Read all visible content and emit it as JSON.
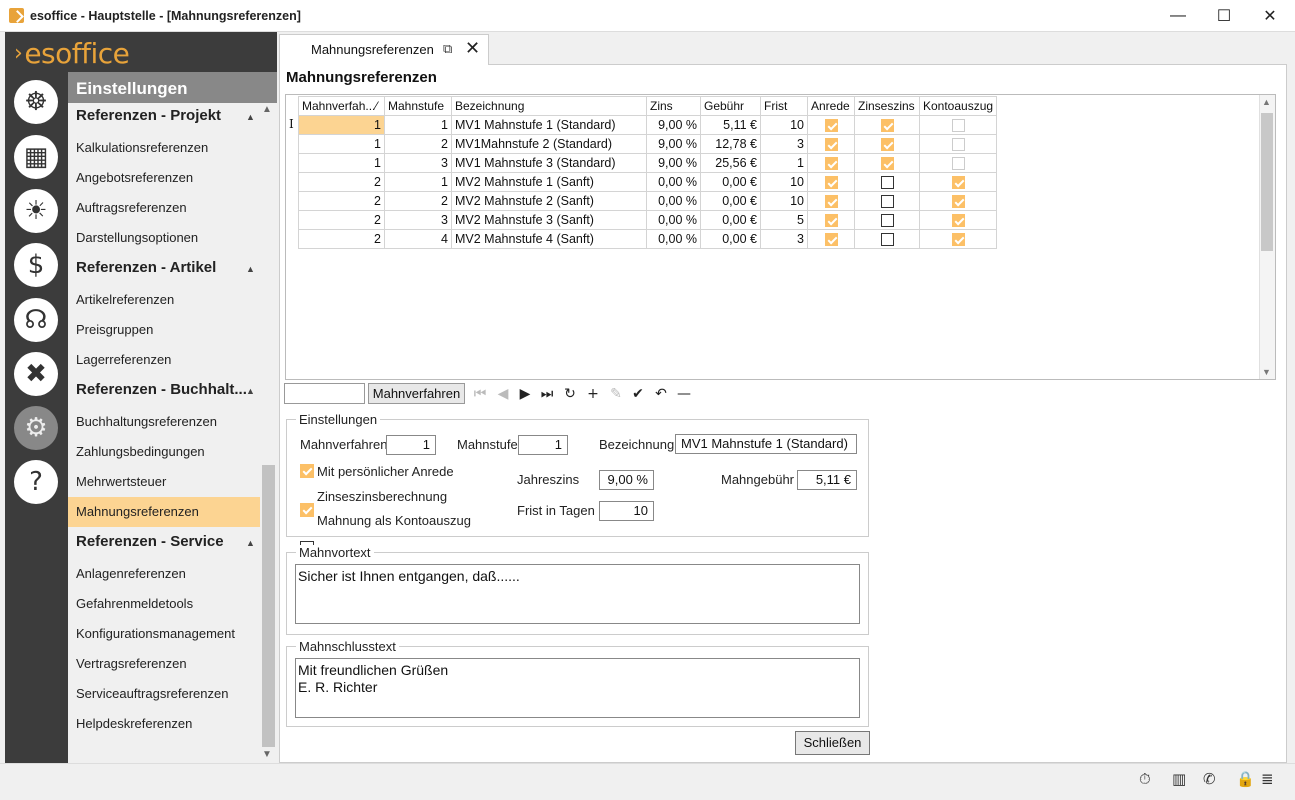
{
  "window": {
    "title": "esoffice - Hauptstelle - [Mahnungsreferenzen]",
    "min": "—",
    "max": "☐",
    "close": "✕"
  },
  "logo": {
    "chevron": "›",
    "text": "esoffice"
  },
  "rail_icons": [
    {
      "icon": "ship-wheel-icon",
      "glyph": "☸"
    },
    {
      "icon": "calculator-icon",
      "glyph": "▦"
    },
    {
      "icon": "alarm-light-icon",
      "glyph": "☀"
    },
    {
      "icon": "money-icon",
      "glyph": "$"
    },
    {
      "icon": "headset-icon",
      "glyph": "☊"
    },
    {
      "icon": "tools-icon",
      "glyph": "✖"
    },
    {
      "icon": "gears-icon",
      "glyph": "⚙"
    },
    {
      "icon": "help-icon",
      "glyph": "?"
    }
  ],
  "nav": {
    "header": "Einstellungen",
    "groups": [
      {
        "title": "Referenzen - Projekt",
        "items": [
          "Kalkulationsreferenzen",
          "Angebotsreferenzen",
          "Auftragsreferenzen",
          "Darstellungsoptionen"
        ]
      },
      {
        "title": "Referenzen - Artikel",
        "items": [
          "Artikelreferenzen",
          "Preisgruppen",
          "Lagerreferenzen"
        ]
      },
      {
        "title": "Referenzen - Buchhalt...",
        "items": [
          "Buchhaltungsreferenzen",
          "Zahlungsbedingungen",
          "Mehrwertsteuer",
          "Mahnungsreferenzen"
        ]
      },
      {
        "title": "Referenzen - Service",
        "items": [
          "Anlagenreferenzen",
          "Gefahrenmeldetools",
          "Konfigurationsmanagement",
          "Vertragsreferenzen",
          "Serviceauftragsreferenzen",
          "Helpdeskreferenzen"
        ]
      }
    ],
    "caret": "▲"
  },
  "tab": {
    "label": "Mahnungsreferenzen",
    "popout": "⧉",
    "close": "✕"
  },
  "page_title": "Mahnungsreferenzen",
  "grid": {
    "columns": [
      "Mahnverfah...",
      "Mahnstufe",
      "Bezeichnung",
      "Zins",
      "Gebühr",
      "Frist",
      "Anrede",
      "Zinseszins",
      "Kontoauszug"
    ],
    "sort_glyph": "⁄",
    "rows": [
      {
        "verfahren": "1",
        "stufe": "1",
        "bez": "MV1 Mahnstufe 1 (Standard)",
        "zins": "9,00 %",
        "gebuehr": "5,11 €",
        "frist": "10",
        "anrede": "on",
        "zinseszins": "on",
        "konto": "dim"
      },
      {
        "verfahren": "1",
        "stufe": "2",
        "bez": "MV1Mahnstufe 2 (Standard)",
        "zins": "9,00 %",
        "gebuehr": "12,78 €",
        "frist": "3",
        "anrede": "on",
        "zinseszins": "on",
        "konto": "dim"
      },
      {
        "verfahren": "1",
        "stufe": "3",
        "bez": "MV1 Mahnstufe 3 (Standard)",
        "zins": "9,00 %",
        "gebuehr": "25,56 €",
        "frist": "1",
        "anrede": "on",
        "zinseszins": "on",
        "konto": "dim"
      },
      {
        "verfahren": "2",
        "stufe": "1",
        "bez": "MV2 Mahnstufe 1 (Sanft)",
        "zins": "0,00 %",
        "gebuehr": "0,00 €",
        "frist": "10",
        "anrede": "on",
        "zinseszins": "off",
        "konto": "on"
      },
      {
        "verfahren": "2",
        "stufe": "2",
        "bez": "MV2 Mahnstufe 2 (Sanft)",
        "zins": "0,00 %",
        "gebuehr": "0,00 €",
        "frist": "10",
        "anrede": "on",
        "zinseszins": "off",
        "konto": "on"
      },
      {
        "verfahren": "2",
        "stufe": "3",
        "bez": "MV2 Mahnstufe 3 (Sanft)",
        "zins": "0,00 %",
        "gebuehr": "0,00 €",
        "frist": "5",
        "anrede": "on",
        "zinseszins": "off",
        "konto": "on"
      },
      {
        "verfahren": "2",
        "stufe": "4",
        "bez": "MV2 Mahnstufe 4 (Sanft)",
        "zins": "0,00 %",
        "gebuehr": "0,00 €",
        "frist": "3",
        "anrede": "on",
        "zinseszins": "off",
        "konto": "on"
      }
    ],
    "row_cursor": "I",
    "scroll_up": "▲",
    "scroll_down": "▼"
  },
  "toolbar": {
    "filter_value": "",
    "filter_button": "Mahnverfahren",
    "buttons": [
      {
        "name": "first-record-icon",
        "glyph": "⏮",
        "enabled": false
      },
      {
        "name": "prev-record-icon",
        "glyph": "◀",
        "enabled": false
      },
      {
        "name": "next-record-icon",
        "glyph": "▶",
        "enabled": true
      },
      {
        "name": "last-record-icon",
        "glyph": "⏭",
        "enabled": true
      },
      {
        "name": "refresh-icon",
        "glyph": "↻",
        "enabled": true
      },
      {
        "name": "add-icon",
        "glyph": "+",
        "enabled": true
      },
      {
        "name": "edit-icon",
        "glyph": "✎",
        "enabled": false
      },
      {
        "name": "confirm-icon",
        "glyph": "✔",
        "enabled": true
      },
      {
        "name": "undo-icon",
        "glyph": "↶",
        "enabled": true
      },
      {
        "name": "delete-icon",
        "glyph": "—",
        "enabled": true
      }
    ]
  },
  "settings": {
    "legend": "Einstellungen",
    "mahnverfahren_label": "Mahnverfahren",
    "mahnverfahren_value": "1",
    "mahnstufe_label": "Mahnstufe",
    "mahnstufe_value": "1",
    "bezeichnung_label": "Bezeichnung",
    "bezeichnung_value": "MV1 Mahnstufe 1 (Standard)",
    "anrede_label": "Mit persönlicher  Anrede",
    "zinseszins_label": "Zinseszinsberechnung",
    "kontoauszug_label": "Mahnung als Kontoauszug",
    "jahreszins_label": "Jahreszins",
    "jahreszins_value": "9,00 %",
    "frist_label": "Frist in Tagen",
    "frist_value": "10",
    "gebuehr_label": "Mahngebühr",
    "gebuehr_value": "5,11 €"
  },
  "mahnvortext": {
    "legend": "Mahnvortext",
    "value": "Sicher ist Ihnen entgangen, daß......"
  },
  "mahnschlusstext": {
    "legend": "Mahnschlusstext",
    "value": "Mit freundlichen Grüßen\nE. R. Richter"
  },
  "close_button": "Schließen",
  "status_icons": [
    {
      "name": "stopwatch-icon",
      "glyph": "⏱"
    },
    {
      "name": "building-icon",
      "glyph": "▥"
    },
    {
      "name": "phone-icon",
      "glyph": "✆"
    },
    {
      "name": "lock-icon",
      "glyph": "🔒"
    },
    {
      "name": "database-icon",
      "glyph": "≣"
    }
  ],
  "colors": {
    "accent": "#e8a33a",
    "checkbox_on": "#fcc067",
    "nav_selected": "#fcd492",
    "rail": "#3c3c3c"
  }
}
